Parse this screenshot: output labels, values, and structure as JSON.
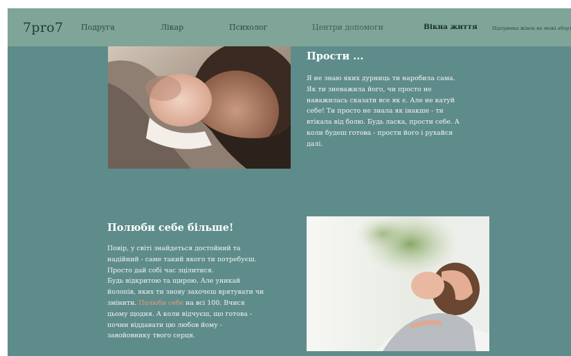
{
  "nav": {
    "logo": "7pro7",
    "items": [
      "Подруга",
      "Лікар",
      "Психолог",
      "Центри допомоги",
      "Вікна життя",
      "Підтримка жінок на межі аборту"
    ]
  },
  "section1": {
    "title": "Прости ...",
    "lines": [
      "Я не знаю яких дурниць ти наробила сама.",
      "Як ти зневажила його, чи просто не",
      "наважилась сказати все як є. Але не катуй",
      "себе! Ти просто не знала як інакше - ти",
      "втікала від болю. Будь ласка, прости себе. А",
      "коли будеш готова - прости його і рухайся",
      "далі."
    ]
  },
  "section2": {
    "title": "Полюби себе більше!",
    "lines": [
      "Повір, у світі знайдеться достойний та",
      "надійний - саме такий якого ти потребуєш.",
      "Просто дай собі час зцілитися.",
      "Будь відкритою та щирою. Але уникай",
      "йолопів, яких ти знову захочеш врятувати чи"
    ],
    "line6_before": "змінити. ",
    "link": "Полюби себе",
    "line6_after": " на всі 100. Вчися",
    "lines_after": [
      "цьому щодня. А коли відчуєш, що готова -",
      "почни віддавати цю любов йому -",
      "завойовнику твого серця."
    ]
  },
  "images": {
    "photo1": "father-with-newborn-photo",
    "photo2": "relaxed-woman-photo"
  },
  "colors": {
    "background": "#5e8c8b",
    "nav": "#7ea598",
    "link": "#e39d7a",
    "text": "#ffffff"
  }
}
